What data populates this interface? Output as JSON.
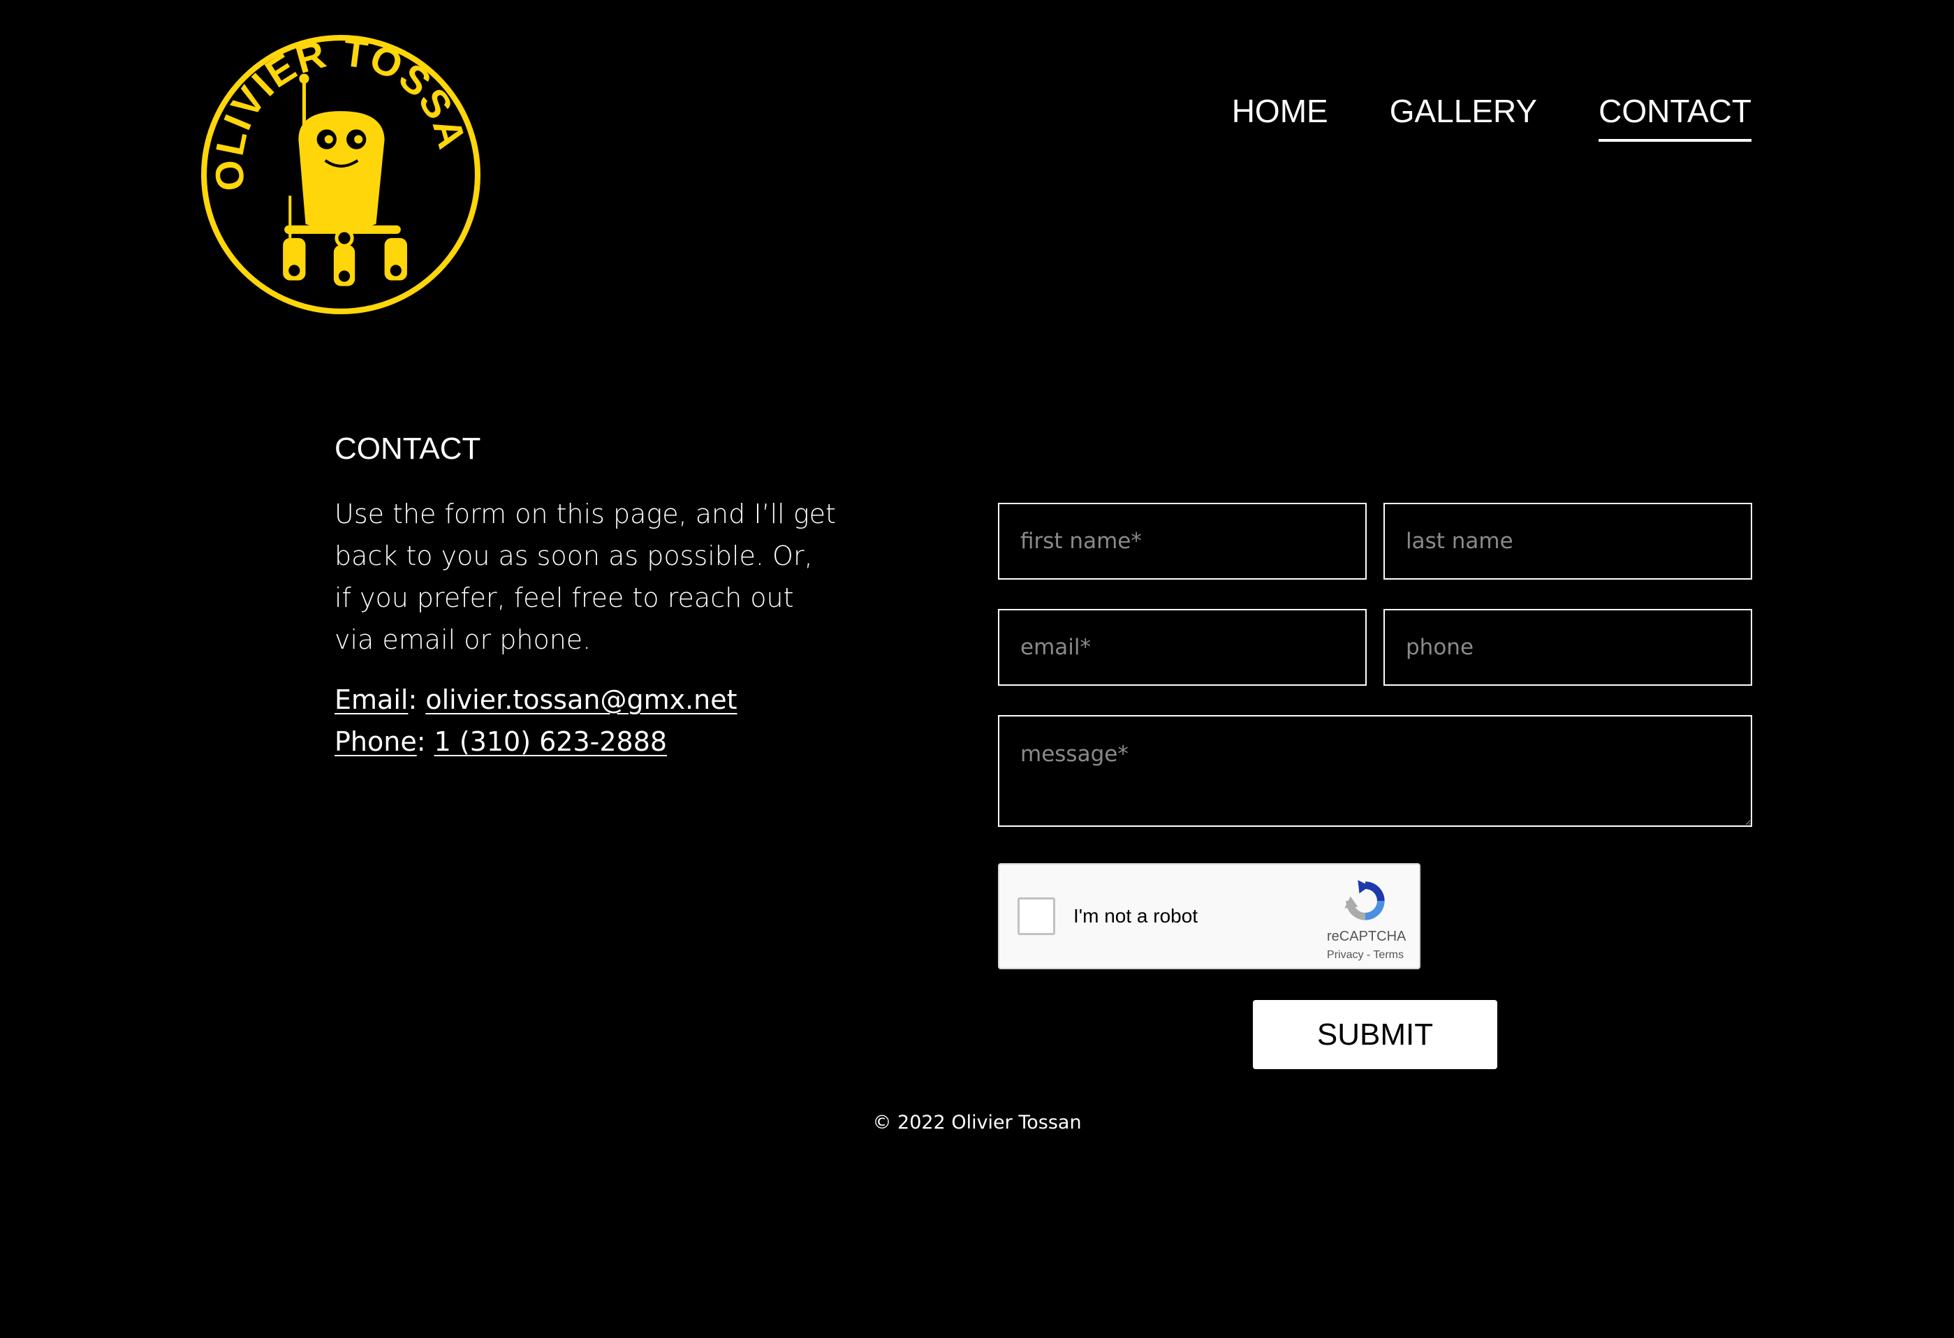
{
  "brand": {
    "logo_text": "OLIVIER TOSSAN",
    "logo_color": "#FFD60A"
  },
  "nav": {
    "items": [
      {
        "label": "HOME",
        "active": false
      },
      {
        "label": "GALLERY",
        "active": false
      },
      {
        "label": "CONTACT",
        "active": true
      }
    ]
  },
  "contact": {
    "title": "CONTACT",
    "intro": "Use the form on this page, and I’ll get back to you as soon as possible. Or, if you prefer, feel free to reach out via email or phone.",
    "email_label": "Email",
    "email_value": "olivier.tossan@gmx.net",
    "phone_label": "Phone",
    "phone_value": "1 (310) 623-2888"
  },
  "form": {
    "first_name_placeholder": "first name*",
    "last_name_placeholder": "last name",
    "email_placeholder": "email*",
    "phone_placeholder": "phone",
    "message_placeholder": "message*",
    "submit_label": "SUBMIT"
  },
  "recaptcha": {
    "label": "I'm not a robot",
    "brand": "reCAPTCHA",
    "links": "Privacy - Terms"
  },
  "footer": {
    "copyright": "© 2022 Olivier Tossan"
  },
  "colors": {
    "background": "#000000",
    "text": "#FFFFFF",
    "accent": "#FFD60A"
  }
}
